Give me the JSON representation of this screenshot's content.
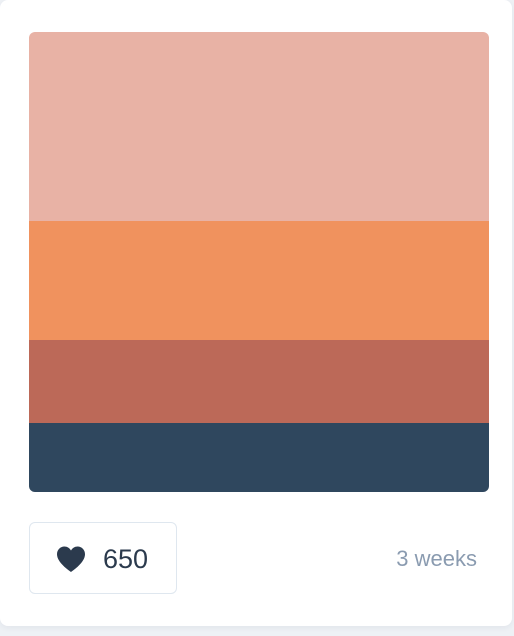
{
  "palette": {
    "colors": [
      "#e8b2a5",
      "#f0925e",
      "#bc6958",
      "#2f475e"
    ]
  },
  "likes": {
    "count": "650",
    "icon": "heart-icon"
  },
  "meta": {
    "time_ago": "3 weeks"
  }
}
